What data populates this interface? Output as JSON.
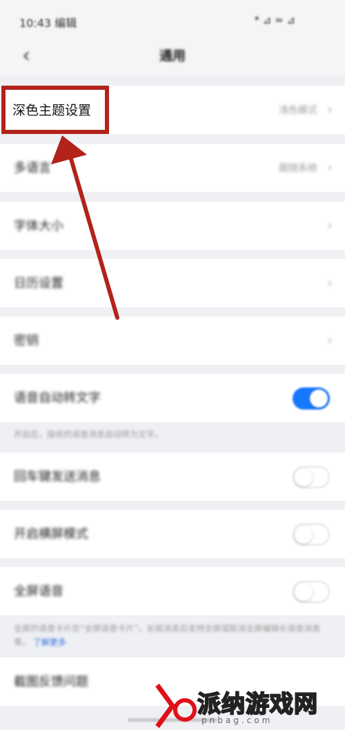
{
  "status_bar": {
    "time": "10:43 编辑",
    "icons": "* ⊿ ≈ ⊿"
  },
  "nav": {
    "title": "通用"
  },
  "settings": {
    "dark_theme": {
      "label": "深色主题设置",
      "value": "浅色模式"
    },
    "language": {
      "label": "多语言",
      "value": "跟随系统"
    },
    "font_size": {
      "label": "字体大小"
    },
    "calendar": {
      "label": "日历设置"
    },
    "privacy": {
      "label": "密钥"
    },
    "voice_to_text": {
      "label": "语音自动转文字",
      "on": true
    },
    "voice_note": "开启后，接收的语音消息自动转为文字。",
    "enter_send": {
      "label": "回车键发送消息",
      "on": false
    },
    "landscape": {
      "label": "开启横屏模式",
      "on": false
    },
    "fullscreen_voice": {
      "label": "全屏语音",
      "on": false
    },
    "fullscreen_note": "全屏的语音卡片在“全屏语音卡片”，长按消息后支持全屏或取消全屏编辑长语音消息等。",
    "fullscreen_link": "了解更多",
    "screenshot_feedback": {
      "label": "截图反馈问题"
    }
  },
  "watermark": {
    "text": "派纳游戏网",
    "sub": "pnbag.com"
  },
  "colors": {
    "accent": "#1677ff",
    "highlight": "#b2231c",
    "arrow": "#b2231c"
  },
  "icons": {
    "back": "chevron-left-icon",
    "row_arrow": "chevron-right-icon"
  }
}
